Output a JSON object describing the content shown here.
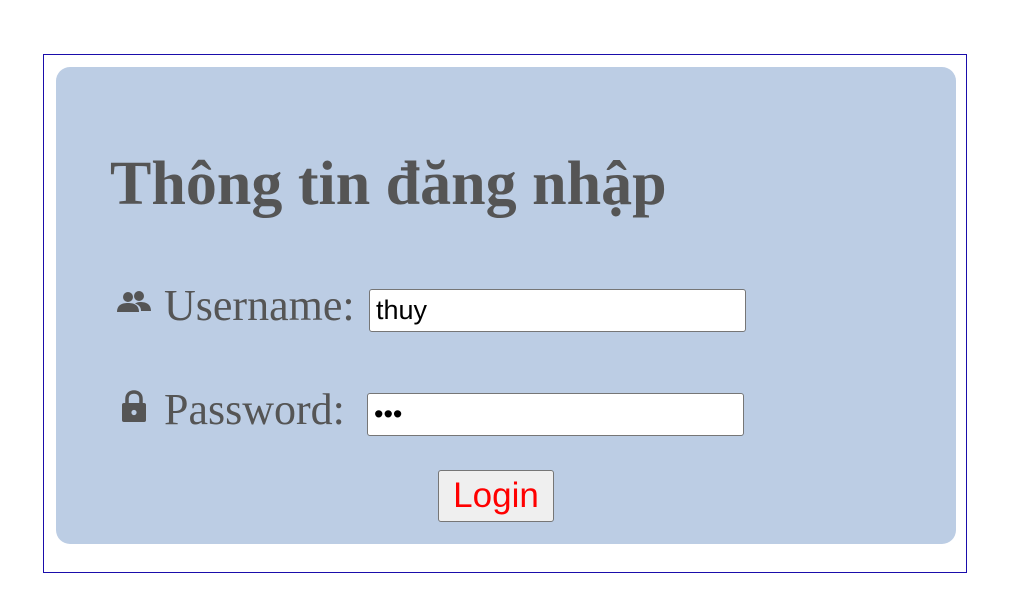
{
  "login_form": {
    "title": "Thông tin đăng nhập",
    "username": {
      "icon": "people-icon",
      "label": "Username:",
      "value": "thuy"
    },
    "password": {
      "icon": "lock-icon",
      "label": "Password:",
      "value": "abc"
    },
    "submit_label": "Login"
  },
  "colors": {
    "panel_background": "#bccde4",
    "frame_border": "#1a0dab",
    "label_text": "#555555",
    "button_text": "#ff0000"
  }
}
